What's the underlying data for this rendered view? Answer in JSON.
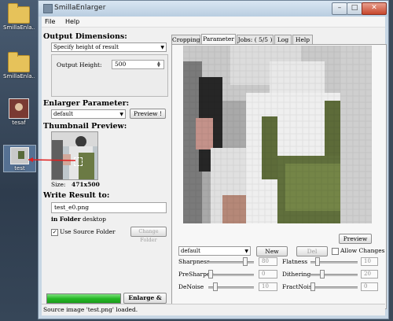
{
  "desktop": {
    "icons": [
      {
        "label": "SmillaEnla..."
      },
      {
        "label": "SmillaEnla..."
      },
      {
        "label": "tesaf"
      },
      {
        "label": "test"
      }
    ]
  },
  "window": {
    "title": "SmillaEnlarger"
  },
  "menu": {
    "items": [
      "File",
      "Help"
    ]
  },
  "output": {
    "title": "Output Dimensions:",
    "mode": "Specify height of result",
    "height_label": "Output Height:",
    "height_value": "500"
  },
  "enlarger": {
    "title": "Enlarger Parameter:",
    "preset": "default",
    "preview_btn": "Preview !"
  },
  "thumb": {
    "title": "Thumbnail Preview:",
    "size_label": "Size:",
    "size_value": "471x500"
  },
  "write": {
    "title": "Write Result to:",
    "filename": "test_e0.png",
    "folder_label": "in Folder",
    "folder_value": "desktop",
    "use_source": "Use Source Folder",
    "change_folder": "Change Folder"
  },
  "progress": {
    "value": 100
  },
  "enlarge_btn": "Enlarge & Save",
  "status": "Source image 'test.png' loaded.",
  "tabs": [
    "Cropping",
    "Parameter",
    "Jobs: ( 5/5 )",
    "Log",
    "Help"
  ],
  "active_tab": "Parameter",
  "preview_btn2": "Preview",
  "params": {
    "preset": "default",
    "new_btn": "New",
    "del_btn": "Del",
    "allow_changes": "Allow Changes",
    "sliders": [
      {
        "label": "Sharpness",
        "value": "80"
      },
      {
        "label": "Flatness",
        "value": "10"
      },
      {
        "label": "PreSharpen",
        "value": "0"
      },
      {
        "label": "Dithering",
        "value": "20"
      },
      {
        "label": "DeNoise",
        "value": "10"
      },
      {
        "label": "FractNoise",
        "value": "0"
      }
    ]
  }
}
